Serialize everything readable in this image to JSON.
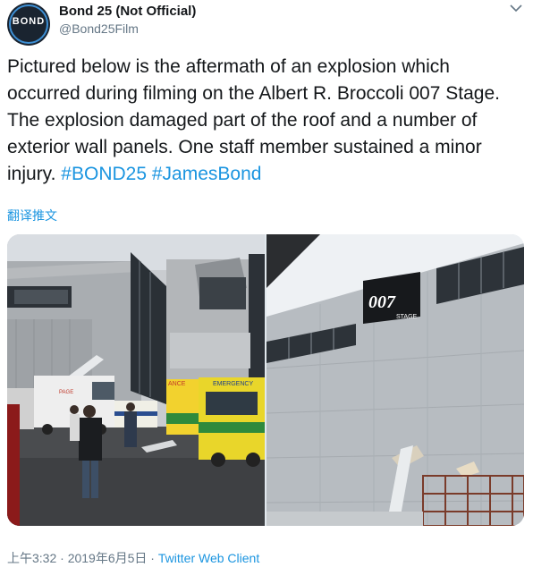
{
  "user": {
    "display_name": "Bond 25 (Not Official)",
    "handle": "@Bond25Film",
    "avatar_text": "BOND"
  },
  "tweet": {
    "text": "Pictured below is the aftermath of an explosion which occurred during filming on the Albert R. Broccoli 007 Stage. The explosion damaged part of the roof and a number of exterior wall panels. One staff member sustained a minor injury. ",
    "hashtags": [
      "#BOND25",
      "#JamesBond"
    ],
    "translate_label": "翻译推文"
  },
  "media": {
    "photo1": {
      "sign_left": "ANCE",
      "sign_emergency": "EMERGENCY",
      "van_text": "PAGE"
    },
    "photo2": {
      "sign_logo": "007",
      "sign_stage": "STAGE"
    }
  },
  "footer": {
    "time": "上午3:32",
    "separator": " · ",
    "date": "2019年6月5日",
    "separator2": " · ",
    "client": "Twitter Web Client"
  },
  "colors": {
    "link": "#1b95e0",
    "text": "#14171a",
    "muted": "#657786"
  }
}
